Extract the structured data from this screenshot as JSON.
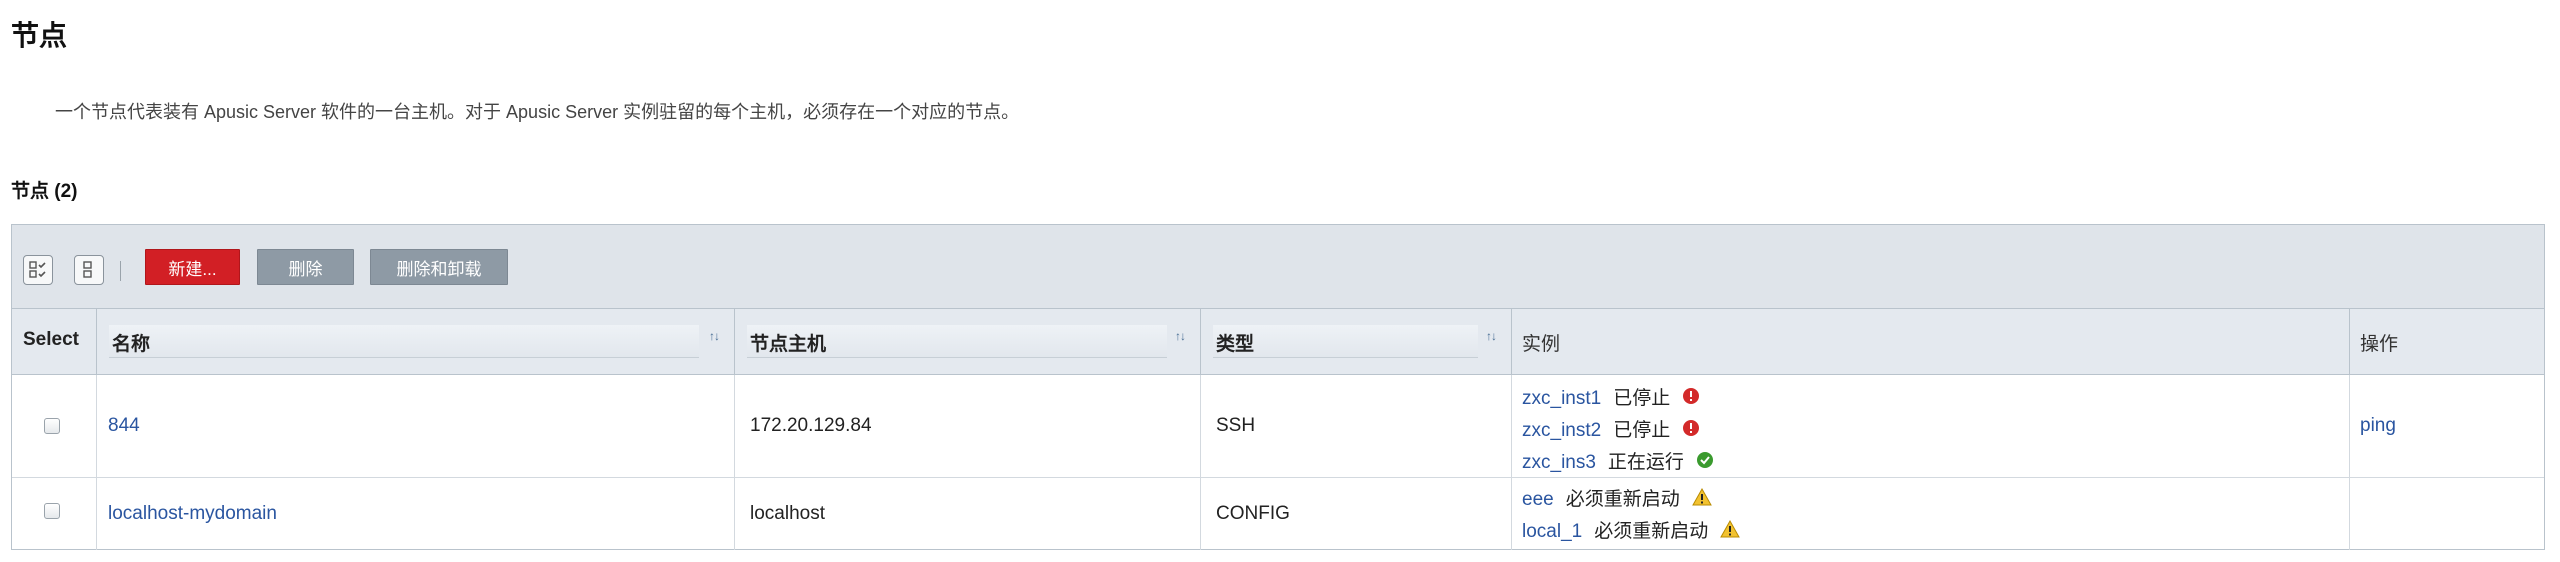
{
  "page": {
    "title": "节点",
    "description": "一个节点代表装有 Apusic Server 软件的一台主机。对于 Apusic Server 实例驻留的每个主机，必须存在一个对应的节点。"
  },
  "section": {
    "title": "节点 (2)"
  },
  "toolbar": {
    "new_label": "新建...",
    "delete_label": "删除",
    "delete_uninstall_label": "删除和卸载"
  },
  "table": {
    "columns": {
      "select": "Select",
      "name": "名称",
      "host": "节点主机",
      "type": "类型",
      "instances": "实例",
      "actions": "操作"
    },
    "rows": [
      {
        "name": "844",
        "host": "172.20.129.84",
        "type": "SSH",
        "instances": [
          {
            "name": "zxc_inst1",
            "status": "已停止",
            "icon": "error-icon"
          },
          {
            "name": "zxc_inst2",
            "status": "已停止",
            "icon": "error-icon"
          },
          {
            "name": "zxc_ins3",
            "status": "正在运行",
            "icon": "ok-icon"
          }
        ],
        "action": "ping"
      },
      {
        "name": "localhost-mydomain",
        "host": "localhost",
        "type": "CONFIG",
        "instances": [
          {
            "name": "eee",
            "status": "必须重新启动",
            "icon": "warning-icon"
          },
          {
            "name": "local_1",
            "status": "必须重新启动",
            "icon": "warning-icon"
          }
        ],
        "action": ""
      }
    ]
  },
  "colors": {
    "primary_button": "#d21f25",
    "secondary_button": "#8e9aa5",
    "link": "#2a55a0",
    "header_bg": "#e4e9ef"
  }
}
